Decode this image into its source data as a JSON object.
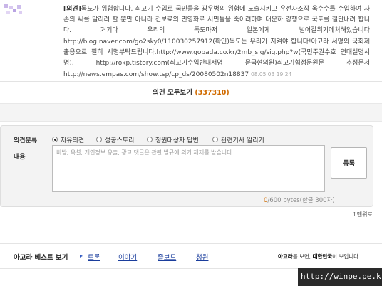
{
  "post": {
    "tag": "[의견]",
    "body": "독도가 위험합니다. 쇠고기 수입로 국민들을 광우병의 위험에 노출시키고 유전자조작 옥수수를 수입하여 자손의 씨를 말리려 할 뿐만 아니라 건보료의 민영화로 서민들을 죽이려하며 대운하 강행으로 국토를 절단내려 합니다. 거기다 우리의 독도마저 일본에게 넘어갈위기에처해있습니다 http://blog.naver.com/go2sky0/110030257912(확인)독도는 우리가 지켜야 합니다!아고라 서명외 국회제출용으로 필히 서명부탁드립니다.http://www.gobada.co.kr/2mb_sig/sig.php?w(국민주권수호 연대실명서명), http://rokp.tistory.com(쇠고기수입반대서명 문국현의원)쇠고기협정문원문 추정문서http://news.empas.com/show.tsp/cp_ds/20080502n18837",
    "date": "08.05.03 19:24"
  },
  "viewall": {
    "label": "의견 모두보기",
    "count": "(337310)"
  },
  "form": {
    "category_label": "의견분류",
    "content_label": "내용",
    "options": [
      "자유의견",
      "성공스토리",
      "청원대상자 답변",
      "관련기사 알리기"
    ],
    "selected": "자유의견",
    "placeholder": "비방, 욕설, 개인정보 유출, 광고 댓글은 관련 법규에 의거 제재를 받습니다.",
    "submit": "등록",
    "counter_current": "0",
    "counter_total": "/600 bytes(한글 300자)"
  },
  "top_link": "↑맨위로",
  "best": {
    "title": "아고라 베스트 보기",
    "links": [
      "토론",
      "이야기",
      "즐보드",
      "청원"
    ]
  },
  "slogan": {
    "pre": "아고라",
    "mid": "를 보면, ",
    "strong": "대한민국",
    "post": "이 보입니다."
  },
  "watermark": "http://winpe.pe.kr",
  "colors": {
    "accent": "#d06b00",
    "link": "#1a3d9c"
  }
}
